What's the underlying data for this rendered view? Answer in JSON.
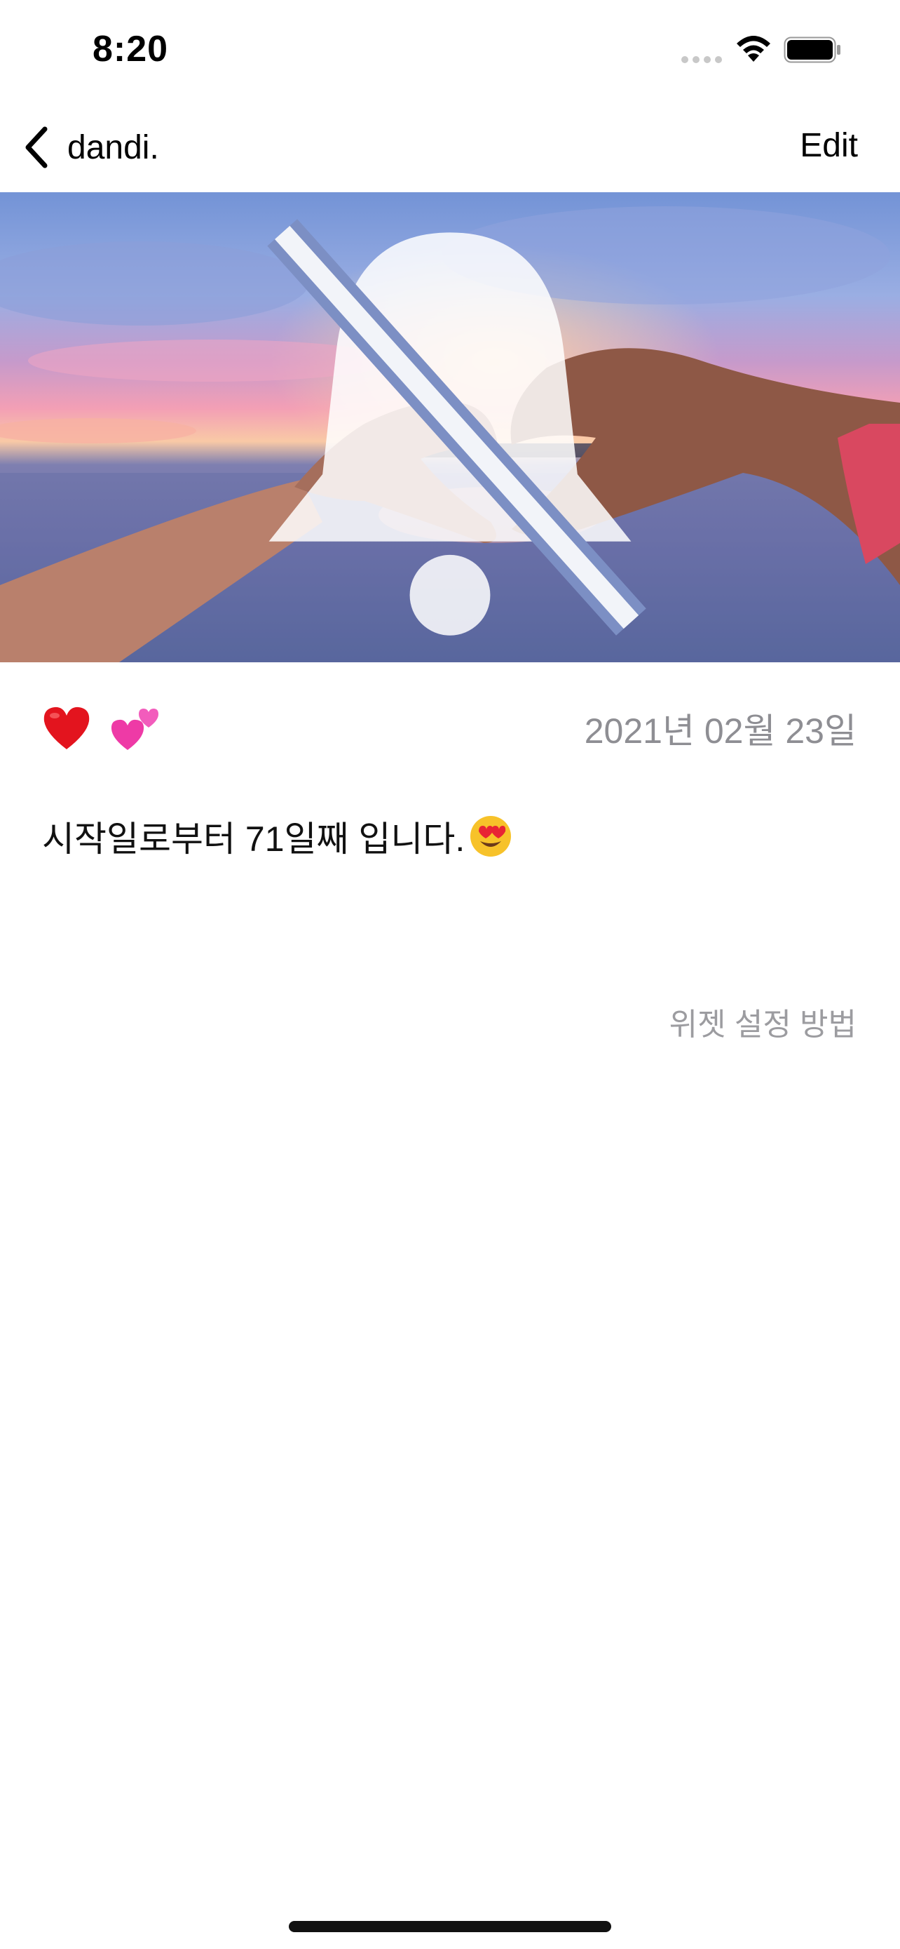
{
  "status_bar": {
    "time": "8:20"
  },
  "nav": {
    "back_label": "dandi.",
    "edit_label": "Edit"
  },
  "hero": {
    "description_icon": "bell-slash-icon"
  },
  "content": {
    "emoji": [
      "❤️",
      "💕"
    ],
    "date": "2021년 02월 23일",
    "message": "시작일로부터 71일째 입니다.",
    "message_emoji": "😍",
    "widget_link": "위젯 설정 방법"
  },
  "colors": {
    "date_text": "#8e8e93",
    "widget_link_text": "#9c9ca0",
    "background": "#ffffff"
  }
}
